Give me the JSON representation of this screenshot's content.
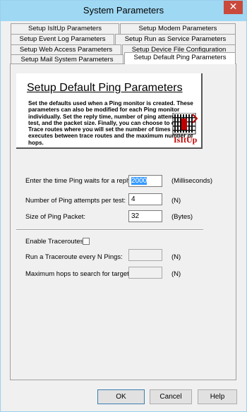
{
  "window": {
    "title": "System Parameters"
  },
  "tabs": [
    "Setup IsItUp Parameters",
    "Setup Modem Parameters",
    "Setup Event Log Parameters",
    "Setup Run as Service Parameters",
    "Setup Web Access Parameters",
    "Setup Device File Configuration",
    "Setup Mail System Parameters",
    "Setup Default Ping Parameters"
  ],
  "header": {
    "title": "Setup Default Ping Parameters",
    "description": "Set the defaults used when a Ping monitor is created. These parameters can also be modified for each Ping monitor individually. Set the reply time, number of ping attempts per test, and the packet size. Finally, you can choose to enable Trace routes where you will set the number of times ping executes between trace routes and the maximum number of hops.",
    "logo_text": "IsItUp"
  },
  "fields": {
    "wait_label": "Enter the time Ping waits for a reply:",
    "wait_value": "2000",
    "wait_unit": "(Milliseconds)",
    "attempts_label": "Number of Ping attempts per test:",
    "attempts_value": "4",
    "attempts_unit": "(N)",
    "packet_label": "Size of Ping Packet:",
    "packet_value": "32",
    "packet_unit": "(Bytes)",
    "traceroute_label": "Enable Traceroutes:",
    "every_label": "Run a Traceroute every N Pings:",
    "every_unit": "(N)",
    "hops_label": "Maximum hops to search for target:",
    "hops_unit": "(N)"
  },
  "buttons": {
    "ok": "OK",
    "cancel": "Cancel",
    "help": "Help"
  }
}
